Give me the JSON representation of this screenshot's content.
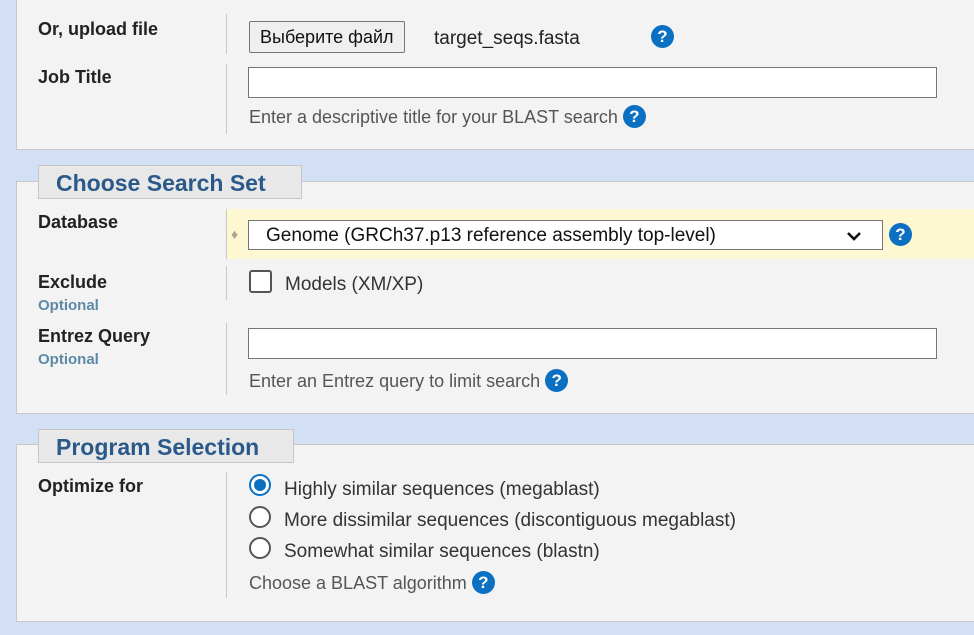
{
  "upload": {
    "label": "Or, upload file",
    "button_label": "Выберите файл",
    "file_name": "target_seqs.fasta"
  },
  "job_title": {
    "label": "Job Title",
    "value": "",
    "hint": "Enter a descriptive title for your BLAST search"
  },
  "search_set": {
    "legend": "Choose Search Set",
    "database": {
      "label": "Database",
      "selected": "Genome (GRCh37.p13 reference assembly top-level)"
    },
    "exclude": {
      "label": "Exclude",
      "optional": "Optional",
      "checkbox_label": "Models (XM/XP)",
      "checked": false
    },
    "entrez": {
      "label": "Entrez Query",
      "optional": "Optional",
      "value": "",
      "hint": "Enter an Entrez query to limit search"
    }
  },
  "program": {
    "legend": "Program Selection",
    "label": "Optimize for",
    "options": [
      {
        "label": "Highly similar sequences (megablast)",
        "selected": true
      },
      {
        "label": "More dissimilar sequences (discontiguous megablast)",
        "selected": false
      },
      {
        "label": "Somewhat similar sequences (blastn)",
        "selected": false
      }
    ],
    "hint": "Choose a BLAST algorithm"
  },
  "help_glyph": "?",
  "colors": {
    "help_icon": "#0b6fc2",
    "legend_text": "#2b5a8a",
    "optional_text": "#5b8aa6",
    "database_highlight": "#fdf8d2",
    "page_background": "#d3dff4"
  }
}
